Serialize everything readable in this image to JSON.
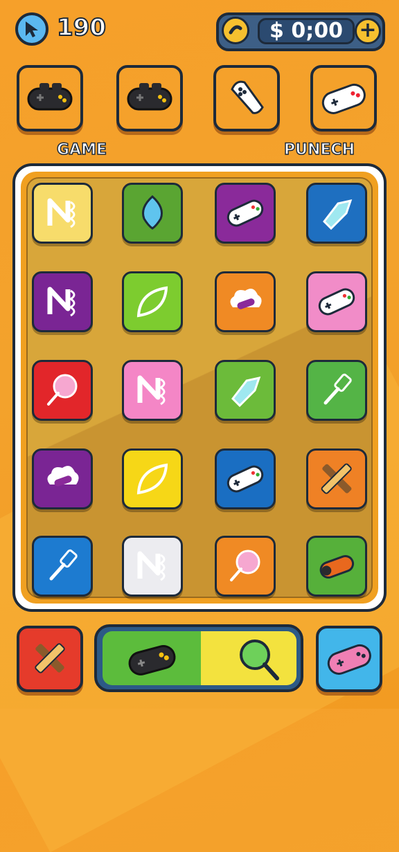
{
  "hud": {
    "score": "190",
    "money": "$ 0;00",
    "plus": "+",
    "icons": [
      "cursor-icon",
      "coin-icon",
      "plus-icon"
    ]
  },
  "categories": [
    {
      "name": "gamepad",
      "color": "#f7d40f",
      "label": "GAME"
    },
    {
      "name": "gamepad",
      "color": "#6cc435",
      "label": ""
    },
    {
      "name": "ghost-card",
      "color": "#e8322c",
      "label": ""
    },
    {
      "name": "gamepad",
      "color": "#42b6ea",
      "label": "PUNECH"
    }
  ],
  "board": {
    "tiles": [
      {
        "icon": "n-logo-icon",
        "color": "#f7dc6b"
      },
      {
        "icon": "balloon-icon",
        "color": "#5aa532"
      },
      {
        "icon": "gamepad-icon",
        "color": "#8a2a9a"
      },
      {
        "icon": "crystal-icon",
        "color": "#1e6fc0"
      },
      {
        "icon": "n-logo-icon",
        "color": "#7a2594"
      },
      {
        "icon": "leaf-icon",
        "color": "#7dcc2f"
      },
      {
        "icon": "cloud-gamepad-icon",
        "color": "#f08a24"
      },
      {
        "icon": "gamepad-icon",
        "color": "#f18cc8"
      },
      {
        "icon": "lollipop-icon",
        "color": "#e2262a"
      },
      {
        "icon": "n-logo-icon",
        "color": "#f486c6"
      },
      {
        "icon": "crystal-icon",
        "color": "#6cbb3a"
      },
      {
        "icon": "hammer-icon",
        "color": "#54b446"
      },
      {
        "icon": "cloud-gamepad-icon",
        "color": "#7a2594"
      },
      {
        "icon": "leaf-icon",
        "color": "#f6d717"
      },
      {
        "icon": "gamepad-icon",
        "color": "#1a6ec2"
      },
      {
        "icon": "crossed-planks-icon",
        "color": "#ef8125"
      },
      {
        "icon": "hammer-icon",
        "color": "#1d7bd0"
      },
      {
        "icon": "n-logo-icon",
        "color": "#ececf0"
      },
      {
        "icon": "lollipop-icon",
        "color": "#f08a24"
      },
      {
        "icon": "log-gamepad-icon",
        "color": "#56b03a"
      }
    ]
  },
  "bottom": {
    "left_icon": "crossed-planks-icon",
    "bar_left_icon": "gamepad-icon",
    "bar_right_icon": "magnifier-icon",
    "right_icon": "gamepad-icon",
    "colors": {
      "left": "#e53b2b",
      "right": "#42b6ea",
      "bar_green": "#5cbc3c",
      "bar_yellow": "#f3e23e"
    }
  }
}
